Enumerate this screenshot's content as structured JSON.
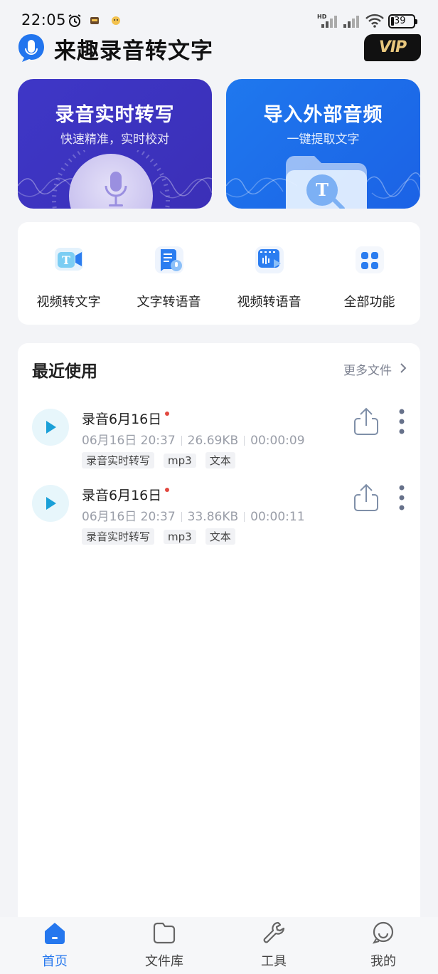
{
  "status_bar": {
    "time": "22:05",
    "battery": "39",
    "network": "HD"
  },
  "header": {
    "app_title": "来趣录音转文字",
    "vip_label": "VIP"
  },
  "hero_cards": [
    {
      "title": "录音实时转写",
      "subtitle": "快速精准，实时校对"
    },
    {
      "title": "导入外部音频",
      "subtitle": "一键提取文字"
    }
  ],
  "quick_actions": [
    {
      "label": "视频转文字",
      "icon": "video-to-text-icon"
    },
    {
      "label": "文字转语音",
      "icon": "text-to-speech-icon"
    },
    {
      "label": "视频转语音",
      "icon": "video-to-speech-icon"
    },
    {
      "label": "全部功能",
      "icon": "all-functions-icon"
    }
  ],
  "recent": {
    "title": "最近使用",
    "more_label": "更多文件",
    "files": [
      {
        "name": "录音6月16日",
        "date": "06月16日 20:37",
        "size": "26.69KB",
        "duration": "00:00:09",
        "tags": [
          "录音实时转写",
          "mp3",
          "文本"
        ]
      },
      {
        "name": "录音6月16日",
        "date": "06月16日 20:37",
        "size": "33.86KB",
        "duration": "00:00:11",
        "tags": [
          "录音实时转写",
          "mp3",
          "文本"
        ]
      }
    ]
  },
  "bottom_nav": [
    {
      "label": "首页",
      "icon": "home-icon",
      "active": true
    },
    {
      "label": "文件库",
      "icon": "folder-icon",
      "active": false
    },
    {
      "label": "工具",
      "icon": "wrench-icon",
      "active": false
    },
    {
      "label": "我的",
      "icon": "profile-icon",
      "active": false
    }
  ],
  "colors": {
    "accent": "#2577ee",
    "hero_record": "#3b2fb7",
    "hero_import": "#1f78ee",
    "play": "#1aa0d8",
    "vip_gold": "#e8c77d"
  }
}
